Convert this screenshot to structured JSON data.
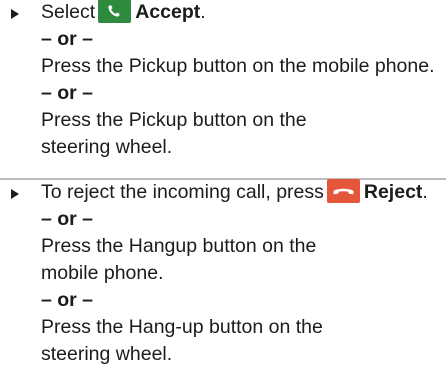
{
  "steps": [
    {
      "select_prefix": "Select",
      "accept_label": "Accept",
      "punct": ".",
      "or_1": "– or –",
      "text_2": "Press the Pickup button on the mobile phone.",
      "or_2": "– or –",
      "text_3": "Press the Pickup button on the steering wheel.",
      "icons": [
        "phone-accept-icon"
      ]
    },
    {
      "reject_prefix": "To reject the incoming call, press",
      "reject_label": "Reject",
      "punct": ".",
      "or_1": "– or –",
      "text_2": "Press the Hangup button on the mobile phone.",
      "or_2": "– or –",
      "text_3": "Press the Hang-up button on the steering wheel.",
      "icons": [
        "phone-reject-icon"
      ]
    }
  ],
  "colors": {
    "accept": "#2e8b3e",
    "reject": "#e5573a",
    "text": "#1c1c1c",
    "divider": "#bdbdbd"
  }
}
